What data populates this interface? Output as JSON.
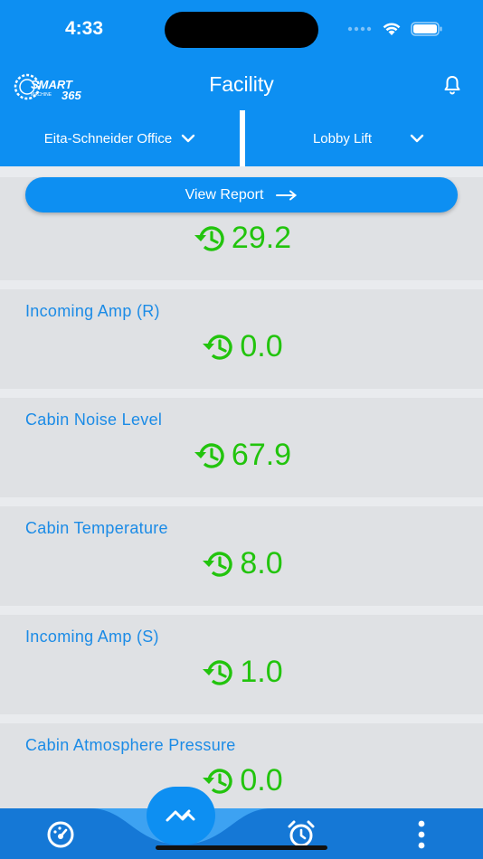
{
  "status": {
    "time": "4:33"
  },
  "header": {
    "title": "Facility",
    "logo_text_top": "SMART",
    "logo_text_mid": "MACHINE",
    "logo_text_num": "365"
  },
  "selectors": {
    "office": "Eita-Schneider Office",
    "lift": "Lobby Lift"
  },
  "view_report": {
    "label": "View Report"
  },
  "cards": [
    {
      "label": "",
      "value": "29.2"
    },
    {
      "label": "Incoming Amp (R)",
      "value": "0.0"
    },
    {
      "label": "Cabin Noise Level",
      "value": "67.9"
    },
    {
      "label": "Cabin Temperature",
      "value": "8.0"
    },
    {
      "label": "Incoming Amp (S)",
      "value": "1.0"
    },
    {
      "label": "Cabin Atmosphere Pressure",
      "value": "0.0"
    }
  ],
  "icons": {
    "history": "history-clock-icon",
    "bell": "bell-icon",
    "dashboard": "dashboard-icon",
    "trend": "trend-icon",
    "alarm": "alarm-clock-icon",
    "more": "more-vertical-icon"
  },
  "colors": {
    "primary": "#0d8ff2",
    "nav": "#1578d6",
    "value_green": "#22c40d",
    "label_blue": "#1b8be6"
  }
}
